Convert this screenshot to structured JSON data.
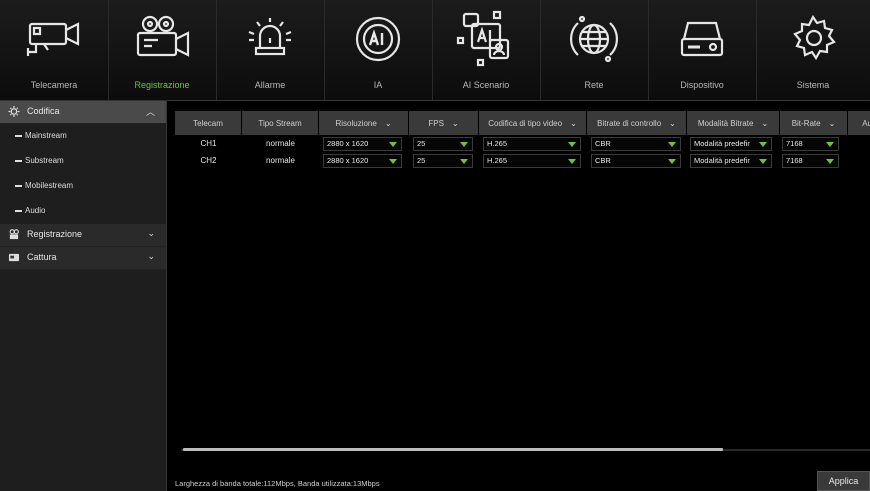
{
  "nav": [
    {
      "label": "Telecamera",
      "icon": "camera-icon",
      "active": false
    },
    {
      "label": "Registrazione",
      "icon": "recording-icon",
      "active": true
    },
    {
      "label": "Allarme",
      "icon": "alarm-icon",
      "active": false
    },
    {
      "label": "IA",
      "icon": "ai-icon",
      "active": false
    },
    {
      "label": "AI Scenario",
      "icon": "ai-scenario-icon",
      "active": false
    },
    {
      "label": "Rete",
      "icon": "network-icon",
      "active": false
    },
    {
      "label": "Dispositivo",
      "icon": "device-icon",
      "active": false
    },
    {
      "label": "Sistema",
      "icon": "system-icon",
      "active": false
    }
  ],
  "sidebar": {
    "groups": [
      {
        "label": "Codifica",
        "icon": "codifica-icon",
        "expanded": true,
        "items": [
          "Mainstream",
          "Substream",
          "Mobilestream",
          "Audio"
        ]
      },
      {
        "label": "Registrazione",
        "icon": "registrazione-icon",
        "expanded": false
      },
      {
        "label": "Cattura",
        "icon": "cattura-icon",
        "expanded": false
      }
    ]
  },
  "table": {
    "headers": [
      "Telecam",
      "Tipo Stream",
      "Risoluzione",
      "FPS",
      "Codifica di tipo video",
      "Bitrate di controllo",
      "Modalità Bitrate",
      "Bit-Rate",
      "Au"
    ],
    "rows": [
      {
        "channel": "CH1",
        "stream_type": "normale",
        "resolution": "2880 x 1620",
        "fps": "25",
        "codec": "H.265",
        "bitrate_control": "CBR",
        "bitrate_mode": "Modalità predefir",
        "bitrate": "7168"
      },
      {
        "channel": "CH2",
        "stream_type": "normale",
        "resolution": "2880 x 1620",
        "fps": "25",
        "codec": "H.265",
        "bitrate_control": "CBR",
        "bitrate_mode": "Modalità predefir",
        "bitrate": "7168"
      }
    ]
  },
  "footer": {
    "bandwidth": "Larghezza di banda totale:112Mbps, Banda utilizzata:13Mbps",
    "apply_label": "Applica"
  },
  "colors": {
    "accent": "#6ec23c",
    "header_bg": "#3a3a3a",
    "sidebar_bg": "#1e1e1e"
  }
}
